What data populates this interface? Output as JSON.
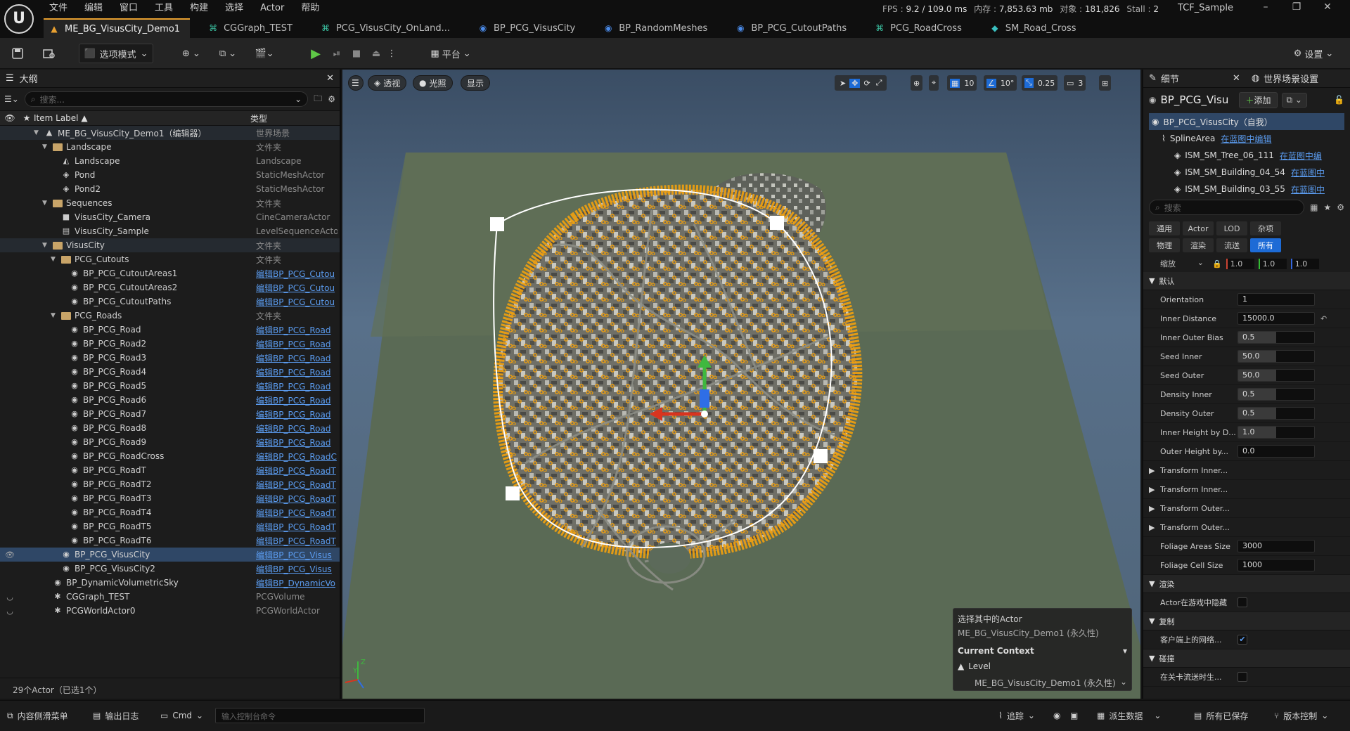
{
  "menu": [
    "文件",
    "编辑",
    "窗口",
    "工具",
    "构建",
    "选择",
    "Actor",
    "帮助"
  ],
  "stats": {
    "fps_label": "FPS :",
    "fps": "9.2 / 109.0 ms",
    "mem_label": "内存 :",
    "mem": "7,853.63 mb",
    "obj_label": "对象 :",
    "obj": "181,826",
    "stall_label": "Stall :",
    "stall": "2"
  },
  "project": "TCF_Sample",
  "tabs": [
    {
      "label": "ME_BG_VisusCity_Demo1",
      "icon": "level-icon",
      "active": true
    },
    {
      "label": "CGGraph_TEST",
      "icon": "graph-icon"
    },
    {
      "label": "PCG_VisusCity_OnLand...",
      "icon": "graph-icon"
    },
    {
      "label": "BP_PCG_VisusCity",
      "icon": "blueprint-icon"
    },
    {
      "label": "BP_RandomMeshes",
      "icon": "blueprint-icon"
    },
    {
      "label": "BP_PCG_CutoutPaths",
      "icon": "blueprint-icon"
    },
    {
      "label": "PCG_RoadCross",
      "icon": "graph-icon"
    },
    {
      "label": "SM_Road_Cross",
      "icon": "mesh-icon"
    }
  ],
  "toolbar": {
    "mode": "选项模式",
    "platform": "平台",
    "settings": "设置"
  },
  "outliner": {
    "title": "大纲",
    "search_placeholder": "搜索...",
    "col_label": "Item Label ▲",
    "col_type": "类型",
    "rows": [
      {
        "label": "ME_BG_VisusCity_Demo1（编辑器）",
        "type": "世界场景",
        "indent": 1,
        "kind": "level",
        "arrow": "▼",
        "grp": true
      },
      {
        "label": "Landscape",
        "type": "文件夹",
        "indent": 2,
        "kind": "folder",
        "arrow": "▼"
      },
      {
        "label": "Landscape",
        "type": "Landscape",
        "indent": 3,
        "kind": "landscape"
      },
      {
        "label": "Pond",
        "type": "StaticMeshActor",
        "indent": 3,
        "kind": "mesh"
      },
      {
        "label": "Pond2",
        "type": "StaticMeshActor",
        "indent": 3,
        "kind": "mesh"
      },
      {
        "label": "Sequences",
        "type": "文件夹",
        "indent": 2,
        "kind": "folder",
        "arrow": "▼"
      },
      {
        "label": "VisusCity_Camera",
        "type": "CineCameraActor",
        "indent": 3,
        "kind": "camera"
      },
      {
        "label": "VisusCity_Sample",
        "type": "LevelSequenceActo",
        "indent": 3,
        "kind": "sequence"
      },
      {
        "label": "VisusCity",
        "type": "文件夹",
        "indent": 2,
        "kind": "folder",
        "arrow": "▼",
        "grp": true
      },
      {
        "label": "PCG_Cutouts",
        "type": "文件夹",
        "indent": 3,
        "kind": "folder",
        "arrow": "▼"
      },
      {
        "label": "BP_PCG_CutoutAreas1",
        "type": "编辑BP_PCG_Cutou",
        "indent": 4,
        "kind": "bp",
        "link": true
      },
      {
        "label": "BP_PCG_CutoutAreas2",
        "type": "编辑BP_PCG_Cutou",
        "indent": 4,
        "kind": "bp",
        "link": true
      },
      {
        "label": "BP_PCG_CutoutPaths",
        "type": "编辑BP_PCG_Cutou",
        "indent": 4,
        "kind": "bp",
        "link": true
      },
      {
        "label": "PCG_Roads",
        "type": "文件夹",
        "indent": 3,
        "kind": "folder",
        "arrow": "▼"
      },
      {
        "label": "BP_PCG_Road",
        "type": "编辑BP_PCG_Road",
        "indent": 4,
        "kind": "bp",
        "link": true
      },
      {
        "label": "BP_PCG_Road2",
        "type": "编辑BP_PCG_Road",
        "indent": 4,
        "kind": "bp",
        "link": true
      },
      {
        "label": "BP_PCG_Road3",
        "type": "编辑BP_PCG_Road",
        "indent": 4,
        "kind": "bp",
        "link": true
      },
      {
        "label": "BP_PCG_Road4",
        "type": "编辑BP_PCG_Road",
        "indent": 4,
        "kind": "bp",
        "link": true
      },
      {
        "label": "BP_PCG_Road5",
        "type": "编辑BP_PCG_Road",
        "indent": 4,
        "kind": "bp",
        "link": true
      },
      {
        "label": "BP_PCG_Road6",
        "type": "编辑BP_PCG_Road",
        "indent": 4,
        "kind": "bp",
        "link": true
      },
      {
        "label": "BP_PCG_Road7",
        "type": "编辑BP_PCG_Road",
        "indent": 4,
        "kind": "bp",
        "link": true
      },
      {
        "label": "BP_PCG_Road8",
        "type": "编辑BP_PCG_Road",
        "indent": 4,
        "kind": "bp",
        "link": true
      },
      {
        "label": "BP_PCG_Road9",
        "type": "编辑BP_PCG_Road",
        "indent": 4,
        "kind": "bp",
        "link": true
      },
      {
        "label": "BP_PCG_RoadCross",
        "type": "编辑BP_PCG_RoadC",
        "indent": 4,
        "kind": "bp",
        "link": true
      },
      {
        "label": "BP_PCG_RoadT",
        "type": "编辑BP_PCG_RoadT",
        "indent": 4,
        "kind": "bp",
        "link": true
      },
      {
        "label": "BP_PCG_RoadT2",
        "type": "编辑BP_PCG_RoadT",
        "indent": 4,
        "kind": "bp",
        "link": true
      },
      {
        "label": "BP_PCG_RoadT3",
        "type": "编辑BP_PCG_RoadT",
        "indent": 4,
        "kind": "bp",
        "link": true
      },
      {
        "label": "BP_PCG_RoadT4",
        "type": "编辑BP_PCG_RoadT",
        "indent": 4,
        "kind": "bp",
        "link": true
      },
      {
        "label": "BP_PCG_RoadT5",
        "type": "编辑BP_PCG_RoadT",
        "indent": 4,
        "kind": "bp",
        "link": true
      },
      {
        "label": "BP_PCG_RoadT6",
        "type": "编辑BP_PCG_RoadT",
        "indent": 4,
        "kind": "bp",
        "link": true
      },
      {
        "label": "BP_PCG_VisusCity",
        "type": "编辑BP_PCG_Visus",
        "indent": 3,
        "kind": "bp",
        "link": true,
        "sel": true,
        "eye": true
      },
      {
        "label": "BP_PCG_VisusCity2",
        "type": "编辑BP_PCG_Visus",
        "indent": 3,
        "kind": "bp",
        "link": true
      },
      {
        "label": "BP_DynamicVolumetricSky",
        "type": "编辑BP_DynamicVo",
        "indent": 2,
        "kind": "bp",
        "link": true
      },
      {
        "label": "CGGraph_TEST",
        "type": "PCGVolume",
        "indent": 2,
        "kind": "pcg",
        "hidden": true
      },
      {
        "label": "PCGWorldActor0",
        "type": "PCGWorldActor",
        "indent": 2,
        "kind": "pcg",
        "hidden": true
      }
    ],
    "footer": "29个Actor（已选1个）"
  },
  "viewport": {
    "menu_icon": "hamburger-icon",
    "view": "透视",
    "lighting": "光照",
    "show": "显示",
    "grid": "10",
    "angle": "10°",
    "scale": "0.25",
    "cam_speed": "3"
  },
  "context": {
    "title": "选择其中的Actor",
    "actor": "ME_BG_VisusCity_Demo1 (永久性)",
    "current": "Current Context",
    "level": "Level",
    "level_value": "ME_BG_VisusCity_Demo1 (永久性)"
  },
  "details": {
    "tab1": "细节",
    "tab2": "世界场景设置",
    "actor": "BP_PCG_Visu",
    "add": "添加",
    "root": "BP_PCG_VisusCity（自我）",
    "components": [
      {
        "label": "SplineArea",
        "link": "在蓝图中编辑",
        "indent": 1
      },
      {
        "label": "ISM_SM_Tree_06_111",
        "link": "在蓝图中编",
        "indent": 2
      },
      {
        "label": "ISM_SM_Building_04_54",
        "link": "在蓝图中",
        "indent": 2
      },
      {
        "label": "ISM_SM_Building_03_55",
        "link": "在蓝图中",
        "indent": 2
      }
    ],
    "search_placeholder": "搜索",
    "filters": [
      "通用",
      "Actor",
      "LOD",
      "杂项",
      "物理",
      "渲染",
      "流送",
      "所有"
    ],
    "scale_label": "缩放",
    "scale": [
      "1.0",
      "1.0",
      "1.0"
    ],
    "section_default": "默认",
    "props": [
      {
        "name": "Orientation",
        "value": "1",
        "fill": 0.0
      },
      {
        "name": "Inner Distance",
        "value": "15000.0",
        "fill": 0.0,
        "reset": true
      },
      {
        "name": "Inner Outer Bias",
        "value": "0.5",
        "fill": 0.5
      },
      {
        "name": "Seed Inner",
        "value": "50.0",
        "fill": 0.5
      },
      {
        "name": "Seed Outer",
        "value": "50.0",
        "fill": 0.5
      },
      {
        "name": "Density Inner",
        "value": "0.5",
        "fill": 0.5
      },
      {
        "name": "Density Outer",
        "value": "0.5",
        "fill": 0.5
      },
      {
        "name": "Inner Height by D...",
        "value": "1.0",
        "fill": 0.5
      },
      {
        "name": "Outer Height by...",
        "value": "0.0",
        "fill": 0.0
      }
    ],
    "structs": [
      "Transform Inner...",
      "Transform Inner...",
      "Transform Outer...",
      "Transform Outer..."
    ],
    "props2": [
      {
        "name": "Foliage Areas Size",
        "value": "3000"
      },
      {
        "name": "Foliage Cell Size",
        "value": "1000"
      }
    ],
    "section_render": "渲染",
    "hide_in_game": "Actor在游戏中隐藏",
    "section_replication": "复制",
    "replicate": "客户端上的网络...",
    "section_collision": "碰撞",
    "collision_prop": "在关卡流送时生..."
  },
  "statusbar": {
    "content_drawer": "内容侧滑菜单",
    "output_log": "输出日志",
    "cmd": "Cmd",
    "cmd_placeholder": "输入控制台命令",
    "trace": "追踪",
    "derived": "派生数据",
    "saved": "所有已保存",
    "source_control": "版本控制"
  }
}
